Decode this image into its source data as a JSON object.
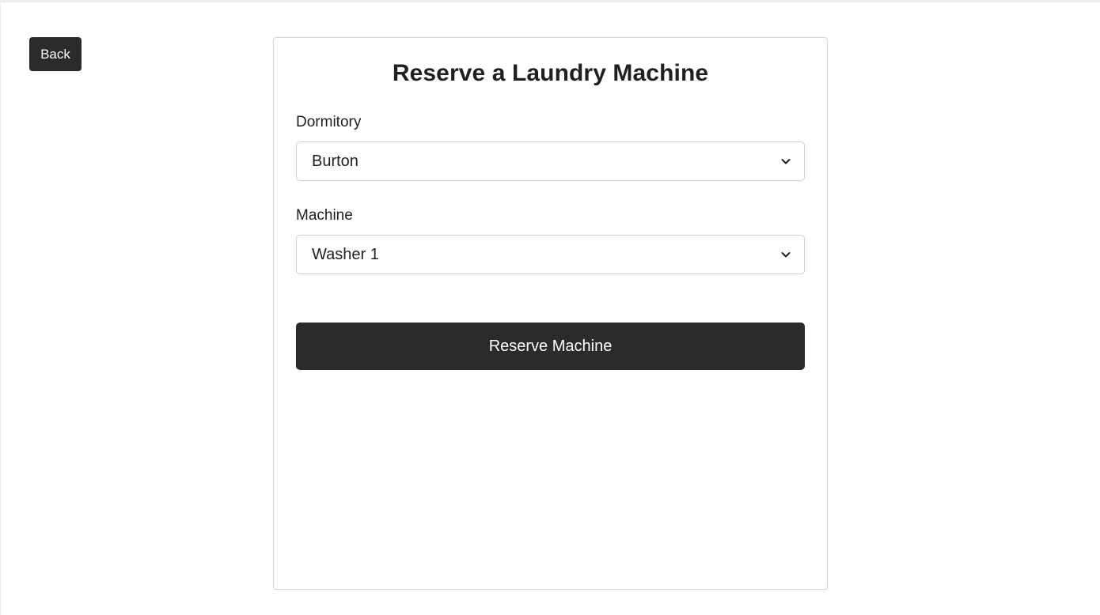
{
  "nav": {
    "back_label": "Back"
  },
  "form": {
    "title": "Reserve a Laundry Machine",
    "dormitory": {
      "label": "Dormitory",
      "value": "Burton",
      "icon": "chevron-down-icon"
    },
    "machine": {
      "label": "Machine",
      "value": "Washer 1",
      "icon": "chevron-down-icon"
    },
    "submit_label": "Reserve Machine"
  },
  "colors": {
    "button_background": "#2b2b2b",
    "button_text": "#ffffff",
    "border": "#cfcfcf",
    "text": "#1f1f1f"
  }
}
